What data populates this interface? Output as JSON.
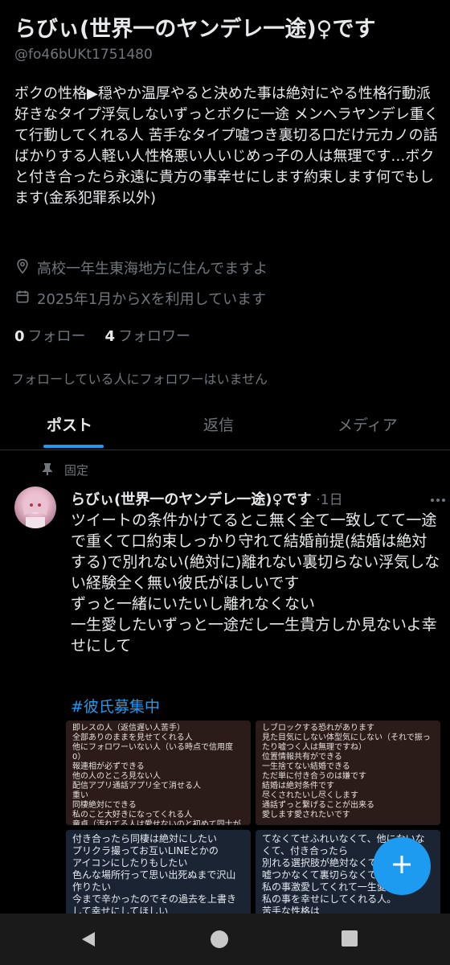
{
  "profile": {
    "display_name": "らびぃ(世界一のヤンデレ一途)♀です",
    "handle": "@fo46bUKt1751480",
    "bio": "ボクの性格▶︎穏やか温厚やると決めた事は絶対にやる性格行動派 好きなタイプ浮気しないずっとボクに一途 メンヘラヤンデレ重くて行動してくれる人 苦手なタイプ嘘つき裏切る口だけ元カノの話ばかりする人軽い人性格悪い人いじめっ子の人は無理です…ボクと付き合ったら永遠に貴方の事幸せにします約束します何でもします(金系犯罪系以外)",
    "location": "高校一年生東海地方に住んでますよ",
    "joined": "2025年1月からXを利用しています",
    "following_count": "0",
    "following_label": "フォロー",
    "followers_count": "4",
    "followers_label": "フォロワー",
    "followers_note": "フォローしている人にフォロワーはいません"
  },
  "tabs": [
    {
      "label": "ポスト",
      "active": true
    },
    {
      "label": "返信",
      "active": false
    },
    {
      "label": "メディア",
      "active": false
    }
  ],
  "post": {
    "pinned_label": "固定",
    "author_name": "らびぃ(世界一のヤンデレ一途)♀です",
    "time": "·1日",
    "body": "ツイートの条件かけてるとこ無く全て一致してて一途で重くて口約束しっかり守れて結婚前提(結婚は絶対する)で別れない(絶対に)離れない裏切らない浮気しない経験全く無い彼氏がほしいです\nずっと一緒にいたいし離れなくない\n一生愛したいずっと一途だし一生貴方しか見ないよ幸せにして",
    "hashtag": "#彼氏募集中",
    "media": [
      "即レスの人（返信遅い人苦手）\n全部ありのままを見せてくれる人\n他にフォロワーいない人（いる時点で信用度0）\n報連相が必ずできる\n他の人のところ見ない人\n配信アプリ通話アプリ全て消せる人\n重い\n同棲絶対にできる\n私のこと大好きになってくれる人\n童貞（汚れてる人は愛せないのと初めて同士が理想だ",
      "しブロックする恐れがあります\n見た目気にしない体型気にしない（それで振ったり嘘つく人は無理ですね）\n位置情報共有ができる\n一生捨てない結婚できる\nただ単に付き合うのは嫌です\n結婚は絶対条件です\n尽くされたいし尽くします\n通話ずっと繋げることが出来る\n愛します愛されたいです",
      "付き合ったら同棲は絶対にしたい\nプリクラ撮ってお互いLINEとかの\nアイコンにしたりもしたい\n色んな場所行って思い出死ぬまで沢山作りたい\n今まで辛かったのでその過去を上書きして幸せにしてほしい",
      "てなくてせふれいなくて、他にないなくて、付き合ったら\n別れる選択肢が絶対なくて\n嘘つかなくて裏切らなくて\n私の事激愛してくれて一生愛\n私の事を幸せにしてくれる人。\n苦手な性格は"
    ]
  },
  "colors": {
    "accent": "#1d9bf0",
    "background": "#000000",
    "secondary_text": "#71767b"
  },
  "icons": {
    "location": "location-pin-icon",
    "calendar": "calendar-icon",
    "pin": "pin-icon",
    "more": "more-horizontal-icon",
    "compose": "plus-icon",
    "nav_back": "triangle-back-icon",
    "nav_home": "circle-home-icon",
    "nav_recents": "square-recents-icon"
  }
}
